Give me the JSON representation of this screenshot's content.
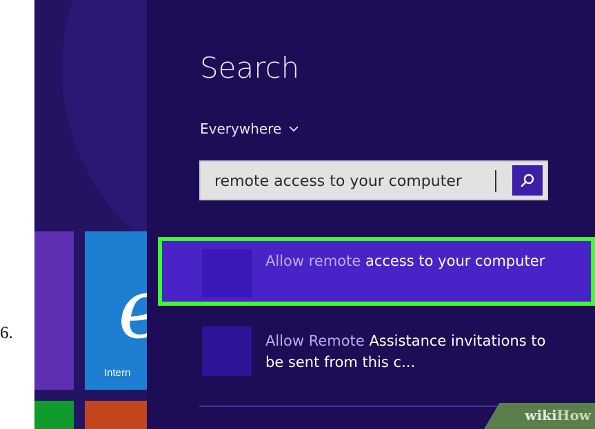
{
  "step": {
    "number": "6."
  },
  "start_screen": {
    "tiles": [
      {
        "name": "purple-tile",
        "color": "#5c2fb3"
      },
      {
        "name": "internet-explorer-tile",
        "color": "#1e7ed1",
        "label": "Intern",
        "icon": "internet-explorer-icon"
      },
      {
        "name": "green-tile",
        "color": "#119b2c"
      },
      {
        "name": "orange-tile",
        "color": "#c2451e"
      }
    ]
  },
  "search_charm": {
    "title": "Search",
    "scope": {
      "label": "Everywhere",
      "icon": "chevron-down-icon"
    },
    "search": {
      "value": "remote access to your computer",
      "button_icon": "search-icon"
    },
    "results": [
      {
        "dim_text": "Allow remote ",
        "bright_text": "access to your computer",
        "selected": true,
        "highlight_color": "#3cff2e"
      },
      {
        "dim_text": "Allow Remote ",
        "bright_text": "Assistance invitations to be sent from this c...",
        "selected": false
      }
    ]
  },
  "watermark": {
    "prefix": "wiki",
    "suffix": "How"
  },
  "colors": {
    "charm_background": "#1d0c56",
    "selected_result": "#4a23c8",
    "search_button": "#3b1fa6"
  }
}
